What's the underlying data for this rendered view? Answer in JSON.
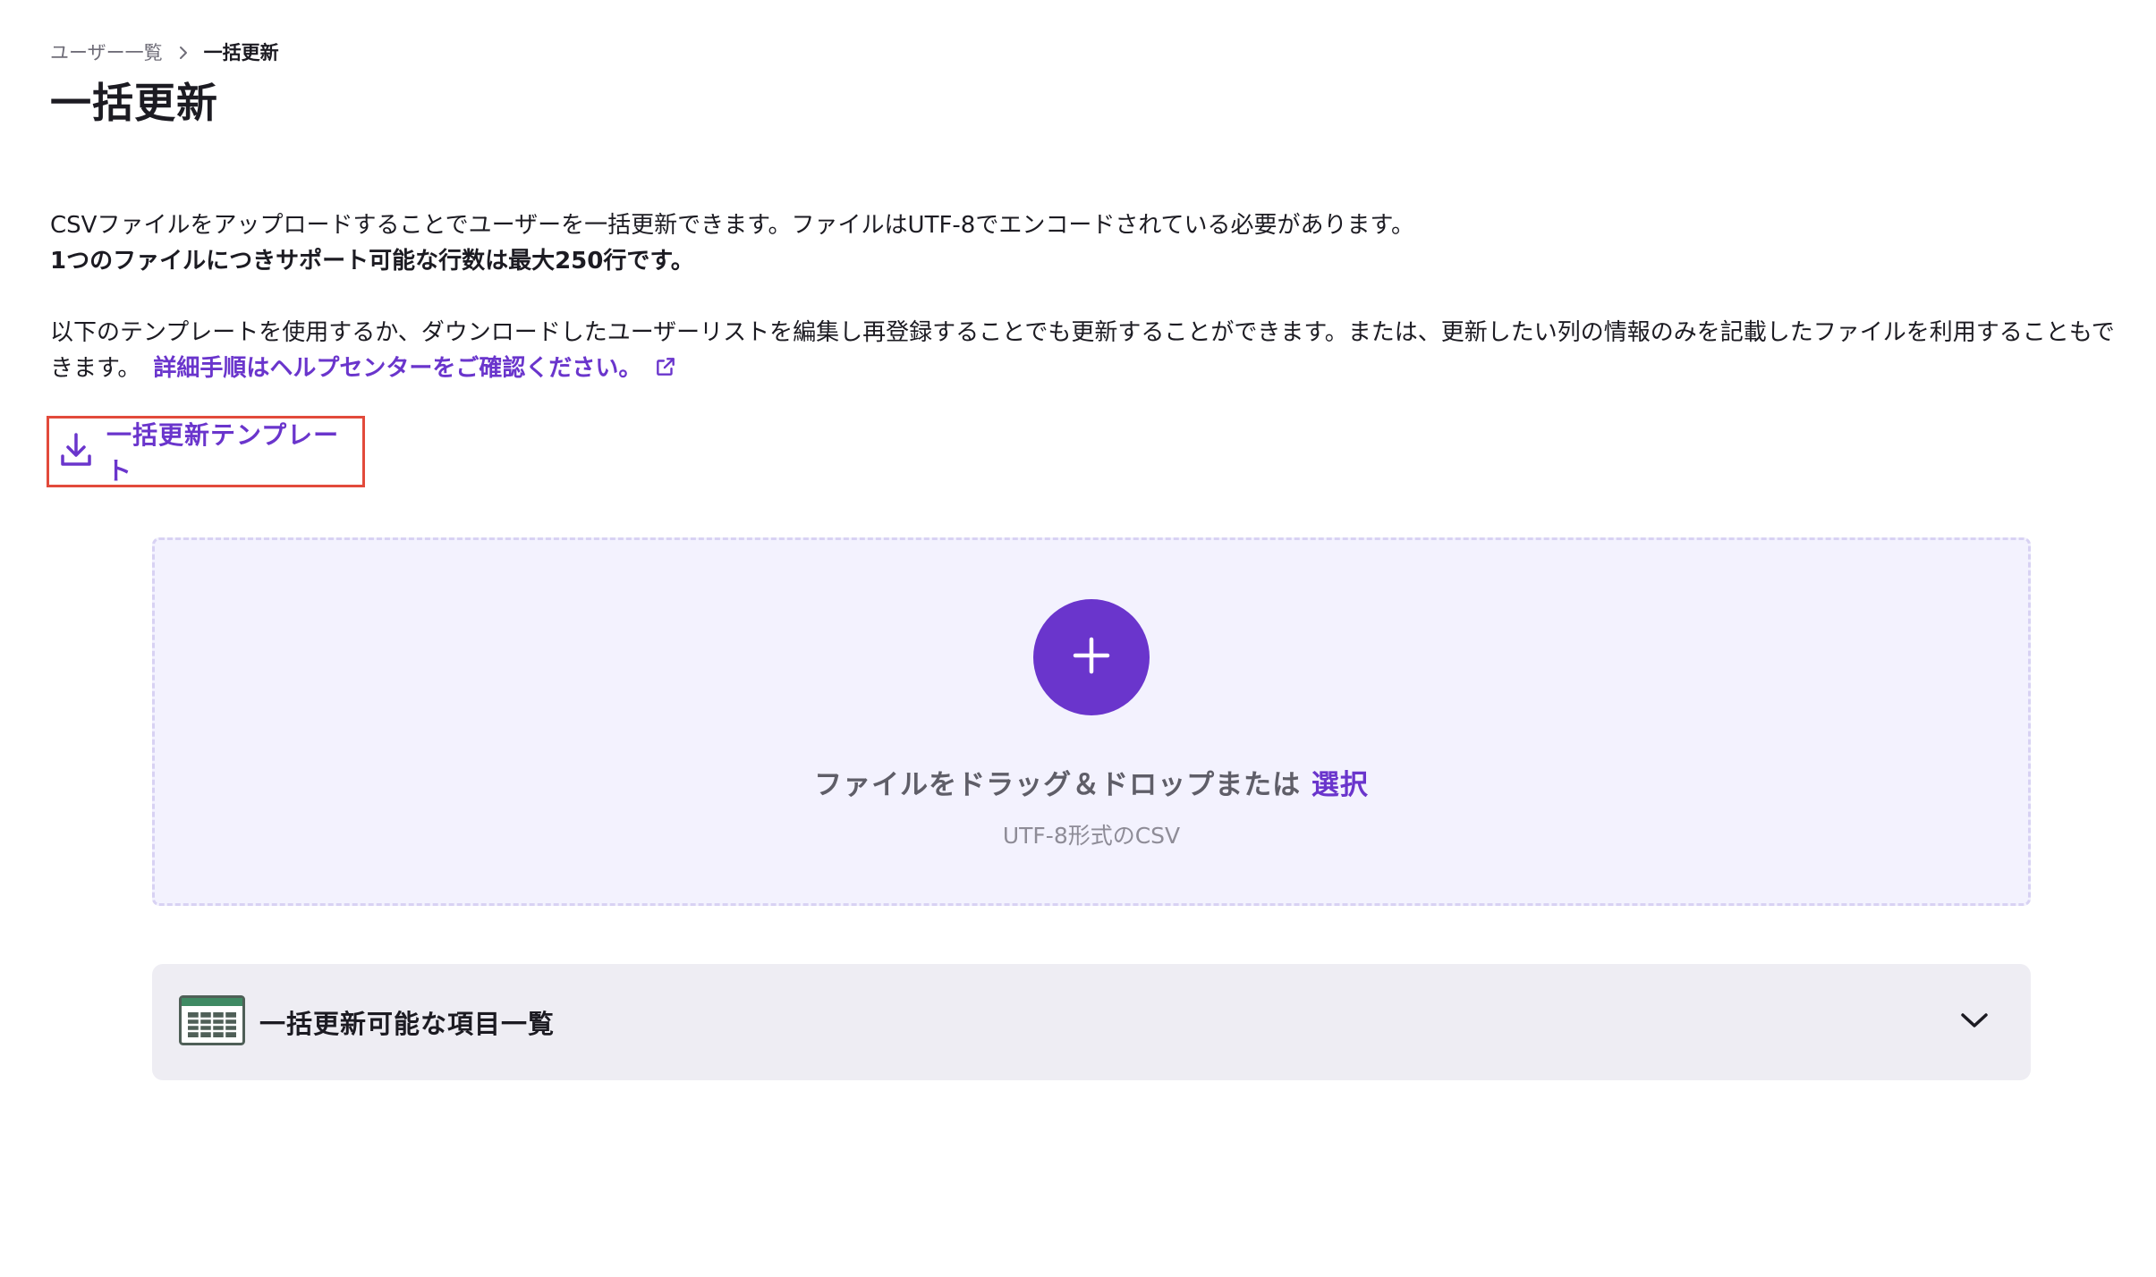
{
  "breadcrumb": {
    "parent": "ユーザー一覧",
    "current": "一括更新"
  },
  "page": {
    "title": "一括更新"
  },
  "description": {
    "line1": "CSVファイルをアップロードすることでユーザーを一括更新できます。ファイルはUTF-8でエンコードされている必要があります。",
    "line2": "1つのファイルにつきサポート可能な行数は最大250行です。",
    "para2": "以下のテンプレートを使用するか、ダウンロードしたユーザーリストを編集し再登録することでも更新することができます。または、更新したい列の情報のみを記載したファイルを利用することもできます。",
    "help_link": "詳細手順はヘルプセンターをご確認ください。"
  },
  "template_button": {
    "label": "一括更新テンプレート"
  },
  "dropzone": {
    "text": "ファイルをドラッグ＆ドロップまたは",
    "select_link": "選択",
    "subtext": "UTF-8形式のCSV"
  },
  "accordion": {
    "title": "一括更新可能な項目一覧"
  },
  "colors": {
    "accent": "#6a35cc",
    "highlight_border": "#e24a3b",
    "dropzone_bg": "#f3f2fe",
    "accordion_bg": "#eeedf3"
  },
  "icons": {
    "breadcrumb_separator": "chevron-right-icon",
    "help_link": "external-link-icon",
    "template_button": "download-icon",
    "dropzone_add": "plus-icon",
    "accordion_leading": "spreadsheet-icon",
    "accordion_toggle": "chevron-down-icon"
  }
}
